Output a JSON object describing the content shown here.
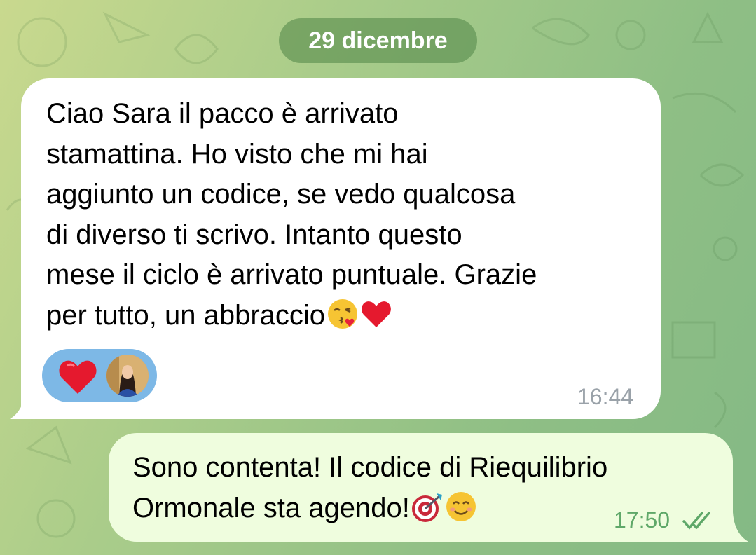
{
  "chat": {
    "date_separator": "29 dicembre",
    "messages": [
      {
        "direction": "incoming",
        "text": "Ciao Sara il pacco è arrivato\nstamattina. Ho visto che mi hai\naggiunto un codice, se vedo qualcosa\ndi diverso ti scrivo. Intanto questo\nmese il ciclo è arrivato puntuale. Grazie\nper tutto,  un abbraccio",
        "trailing_emojis": [
          "face-blowing-a-kiss",
          "red-heart"
        ],
        "time": "16:44",
        "reaction": {
          "emoji": "red-heart",
          "reactor": "user-avatar"
        }
      },
      {
        "direction": "outgoing",
        "text": "Sono contenta! Il codice di Riequilibrio\nOrmonale sta agendo!",
        "trailing_emojis": [
          "direct-hit",
          "smiling-face-with-smiling-eyes"
        ],
        "time": "17:50",
        "status": "read-double-check"
      }
    ]
  },
  "colors": {
    "incoming_bubble": "#ffffff",
    "outgoing_bubble": "#effdde",
    "reaction_pill": "#7db8e6",
    "outgoing_time": "#5fa869",
    "incoming_time": "#9aa2a9"
  }
}
